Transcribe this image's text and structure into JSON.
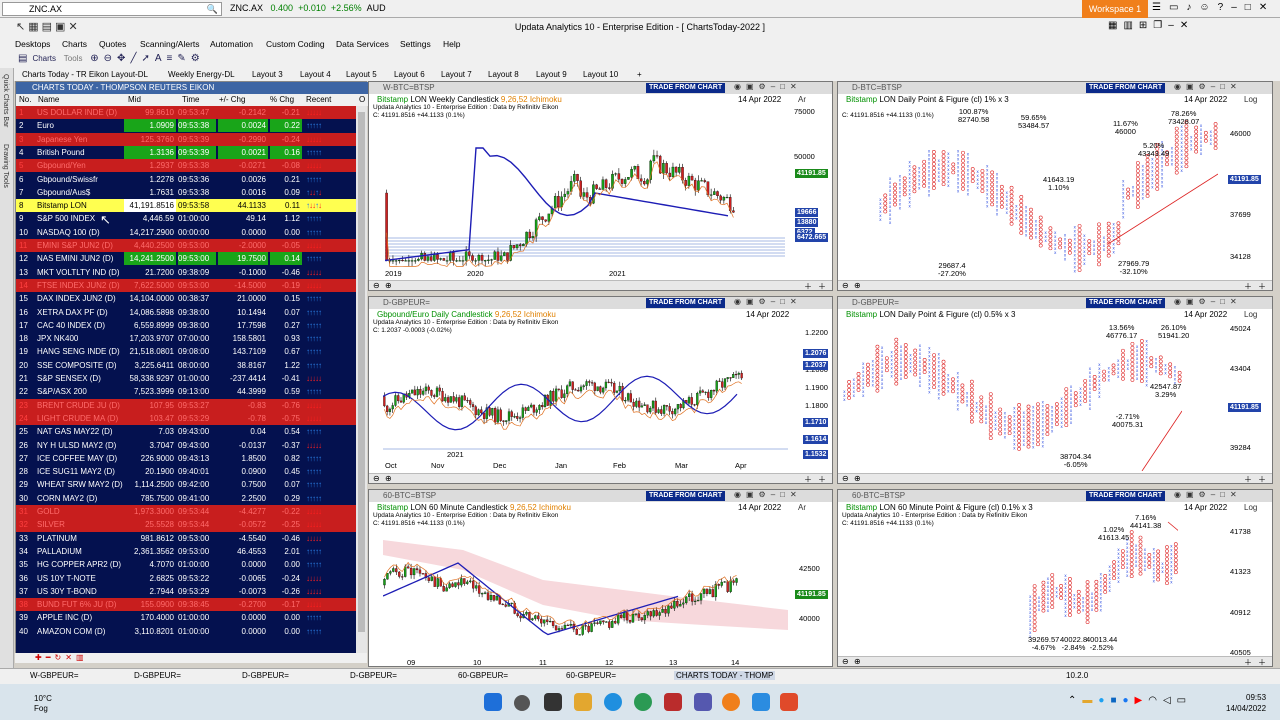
{
  "top": {
    "symbol": "ZNC.AX",
    "quote_symbol": "ZNC.AX",
    "quote_price": "0.400",
    "quote_change": "+0.010",
    "quote_pct": "+2.56%",
    "quote_ccy": "AUD",
    "workspace": "Workspace 1"
  },
  "app_title": "Updata Analytics 10 - Enterprise Edition - [ ChartsToday-2022 ]",
  "menu": [
    "Desktops",
    "Charts",
    "Quotes",
    "Scanning/Alerts",
    "Automation",
    "Custom Coding",
    "Data Services",
    "Settings",
    "Help"
  ],
  "toolbar": {
    "charts_label": "Charts",
    "tools_label": "Tools"
  },
  "layouts": [
    "Charts Today - TR Eikon Layout-DL",
    "Weekly Energy-DL",
    "Layout 3",
    "Layout 4",
    "Layout 5",
    "Layout 6",
    "Layout 7",
    "Layout 8",
    "Layout 9",
    "Layout 10",
    "+"
  ],
  "side_tabs": [
    "Quick Charts Bar",
    "Drawing Tools"
  ],
  "watchlist": {
    "title": "CHARTS TODAY - THOMPSON REUTERS EIKON",
    "columns": [
      "No.",
      "Name",
      "Mid",
      "Time",
      "+/- Chg",
      "% Chg",
      "Recent",
      "O"
    ],
    "rows": [
      {
        "no": "1",
        "name": "US DOLLAR INDE (D)",
        "mid": "99.8610",
        "time": "09:53:47",
        "chg": "-0.2142",
        "pct": "-0.21",
        "style": "red",
        "arrows": "down"
      },
      {
        "no": "2",
        "name": "Euro",
        "mid": "1.0909",
        "time": "09:53:38",
        "chg": "0.0024",
        "pct": "0.22",
        "style": "grn",
        "arrows": "up"
      },
      {
        "no": "3",
        "name": "Japanese Yen",
        "mid": "125.3760",
        "time": "09:53:39",
        "chg": "-0.2990",
        "pct": "-0.24",
        "style": "red",
        "arrows": "down"
      },
      {
        "no": "4",
        "name": "British Pound",
        "mid": "1.3136",
        "time": "09:53:39",
        "chg": "0.0021",
        "pct": "0.16",
        "style": "grn",
        "arrows": "up"
      },
      {
        "no": "5",
        "name": "Gbpound/Yen",
        "mid": "1.2937",
        "time": "09:53:38",
        "chg": "-0.0271",
        "pct": "-0.08",
        "style": "red",
        "arrows": "down"
      },
      {
        "no": "6",
        "name": "Gbpound/Swissfr",
        "mid": "1.2278",
        "time": "09:53:36",
        "chg": "0.0026",
        "pct": "0.21",
        "style": "norm",
        "arrows": "up"
      },
      {
        "no": "7",
        "name": "Gbpound/Aus$",
        "mid": "1.7631",
        "time": "09:53:38",
        "chg": "0.0016",
        "pct": "0.09",
        "style": "norm",
        "arrows": "mix"
      },
      {
        "no": "8",
        "name": "Bitstamp      LON",
        "mid": "41,191.8516",
        "time": "09:53:58",
        "chg": "44.1133",
        "pct": "0.11",
        "style": "sel",
        "arrows": "mix"
      },
      {
        "no": "9",
        "name": "S&P 500 INDEX",
        "mid": "4,446.59",
        "time": "01:00:00",
        "chg": "49.14",
        "pct": "1.12",
        "style": "norm",
        "arrows": "up"
      },
      {
        "no": "10",
        "name": "NASDAQ 100 (D)",
        "mid": "14,217.2900",
        "time": "00:00:00",
        "chg": "0.0000",
        "pct": "0.00",
        "style": "norm",
        "arrows": "up"
      },
      {
        "no": "11",
        "name": "EMINI S&P JUN2 (D)",
        "mid": "4,440.2500",
        "time": "09:53:00",
        "chg": "-2.0000",
        "pct": "-0.05",
        "style": "red",
        "arrows": "down"
      },
      {
        "no": "12",
        "name": "NAS EMINI JUN2 (D)",
        "mid": "14,241.2500",
        "time": "09:53:00",
        "chg": "19.7500",
        "pct": "0.14",
        "style": "grn",
        "arrows": "up"
      },
      {
        "no": "13",
        "name": "MKT VOLTLTY IND (D)",
        "mid": "21.7200",
        "time": "09:38:09",
        "chg": "-0.1000",
        "pct": "-0.46",
        "style": "norm",
        "arrows": "down"
      },
      {
        "no": "14",
        "name": "FTSE INDEX JUN2 (D)",
        "mid": "7,622.5000",
        "time": "09:53:00",
        "chg": "-14.5000",
        "pct": "-0.19",
        "style": "red",
        "arrows": "down"
      },
      {
        "no": "15",
        "name": "DAX INDEX JUN2 (D)",
        "mid": "14,104.0000",
        "time": "00:38:37",
        "chg": "21.0000",
        "pct": "0.15",
        "style": "norm",
        "arrows": "up"
      },
      {
        "no": "16",
        "name": "XETRA DAX PF (D)",
        "mid": "14,086.5898",
        "time": "09:38:00",
        "chg": "10.1494",
        "pct": "0.07",
        "style": "norm",
        "arrows": "up"
      },
      {
        "no": "17",
        "name": "CAC 40 INDEX (D)",
        "mid": "6,559.8999",
        "time": "09:38:00",
        "chg": "17.7598",
        "pct": "0.27",
        "style": "norm",
        "arrows": "up"
      },
      {
        "no": "18",
        "name": "JPX NK400",
        "mid": "17,203.9707",
        "time": "07:00:00",
        "chg": "158.5801",
        "pct": "0.93",
        "style": "norm",
        "arrows": "up"
      },
      {
        "no": "19",
        "name": "HANG SENG INDE (D)",
        "mid": "21,518.0801",
        "time": "09:08:00",
        "chg": "143.7109",
        "pct": "0.67",
        "style": "norm",
        "arrows": "up"
      },
      {
        "no": "20",
        "name": "SSE COMPOSITE (D)",
        "mid": "3,225.6411",
        "time": "08:00:00",
        "chg": "38.8167",
        "pct": "1.22",
        "style": "norm",
        "arrows": "up"
      },
      {
        "no": "21",
        "name": "S&P SENSEX (D)",
        "mid": "58,338.9297",
        "time": "01:00:00",
        "chg": "-237.4414",
        "pct": "-0.41",
        "style": "norm",
        "arrows": "down"
      },
      {
        "no": "22",
        "name": "S&P/ASX 200",
        "mid": "7,523.3999",
        "time": "09:13:00",
        "chg": "44.3999",
        "pct": "0.59",
        "style": "norm",
        "arrows": "up"
      },
      {
        "no": "23",
        "name": "BRENT CRUDE JU (D)",
        "mid": "107.95",
        "time": "09:53:27",
        "chg": "-0.83",
        "pct": "-0.76",
        "style": "red",
        "arrows": "down"
      },
      {
        "no": "24",
        "name": "LIGHT CRUDE MA (D)",
        "mid": "103.47",
        "time": "09:53:29",
        "chg": "-0.78",
        "pct": "-0.75",
        "style": "red",
        "arrows": "down"
      },
      {
        "no": "25",
        "name": "NAT GAS MAY22 (D)",
        "mid": "7.03",
        "time": "09:43:00",
        "chg": "0.04",
        "pct": "0.54",
        "style": "norm",
        "arrows": "up"
      },
      {
        "no": "26",
        "name": "NY H ULSD MAY2 (D)",
        "mid": "3.7047",
        "time": "09:43:00",
        "chg": "-0.0137",
        "pct": "-0.37",
        "style": "norm",
        "arrows": "down"
      },
      {
        "no": "27",
        "name": "ICE COFFEE MAY (D)",
        "mid": "226.9000",
        "time": "09:43:13",
        "chg": "1.8500",
        "pct": "0.82",
        "style": "norm",
        "arrows": "up"
      },
      {
        "no": "28",
        "name": "ICE SUG11 MAY2 (D)",
        "mid": "20.1900",
        "time": "09:40:01",
        "chg": "0.0900",
        "pct": "0.45",
        "style": "norm",
        "arrows": "up"
      },
      {
        "no": "29",
        "name": "WHEAT SRW MAY2 (D)",
        "mid": "1,114.2500",
        "time": "09:42:00",
        "chg": "0.7500",
        "pct": "0.07",
        "style": "norm",
        "arrows": "up"
      },
      {
        "no": "30",
        "name": "CORN MAY2 (D)",
        "mid": "785.7500",
        "time": "09:41:00",
        "chg": "2.2500",
        "pct": "0.29",
        "style": "norm",
        "arrows": "up"
      },
      {
        "no": "31",
        "name": "GOLD",
        "mid": "1,973.3000",
        "time": "09:53:44",
        "chg": "-4.4277",
        "pct": "-0.22",
        "style": "red",
        "arrows": "down"
      },
      {
        "no": "32",
        "name": "SILVER",
        "mid": "25.5528",
        "time": "09:53:44",
        "chg": "-0.0572",
        "pct": "-0.25",
        "style": "red",
        "arrows": "down"
      },
      {
        "no": "33",
        "name": "PLATINUM",
        "mid": "981.8612",
        "time": "09:53:00",
        "chg": "-4.5540",
        "pct": "-0.46",
        "style": "norm",
        "arrows": "down"
      },
      {
        "no": "34",
        "name": "PALLADIUM",
        "mid": "2,361.3562",
        "time": "09:53:00",
        "chg": "46.4553",
        "pct": "2.01",
        "style": "norm",
        "arrows": "up"
      },
      {
        "no": "35",
        "name": "HG COPPER APR2 (D)",
        "mid": "4.7070",
        "time": "01:00:00",
        "chg": "0.0000",
        "pct": "0.00",
        "style": "norm",
        "arrows": "up"
      },
      {
        "no": "36",
        "name": "US 10Y T-NOTE",
        "mid": "2.6825",
        "time": "09:53:22",
        "chg": "-0.0065",
        "pct": "-0.24",
        "style": "norm",
        "arrows": "down"
      },
      {
        "no": "37",
        "name": "US 30Y T-BOND",
        "mid": "2.7944",
        "time": "09:53:29",
        "chg": "-0.0073",
        "pct": "-0.26",
        "style": "norm",
        "arrows": "down"
      },
      {
        "no": "38",
        "name": "BUND FUT 6% JU (D)",
        "mid": "155.0900",
        "time": "09:38:45",
        "chg": "-0.2700",
        "pct": "-0.17",
        "style": "red",
        "arrows": "down"
      },
      {
        "no": "39",
        "name": "APPLE INC (D)",
        "mid": "170.4000",
        "time": "01:00:00",
        "chg": "0.0000",
        "pct": "0.00",
        "style": "norm",
        "arrows": "up"
      },
      {
        "no": "40",
        "name": "AMAZON COM (D)",
        "mid": "3,110.8201",
        "time": "01:00:00",
        "chg": "0.0000",
        "pct": "0.00",
        "style": "norm",
        "arrows": "up"
      }
    ]
  },
  "charts": {
    "tfc": "TRADE FROM CHART",
    "c1": {
      "tab": "W-BTC=BTSP",
      "title_a": "Bitstamp",
      "title_b": "LON Weekly Candlestick",
      "title_c": "9,26,52 Ichimoku",
      "sub": "Updata Analytics 10 - Enterprise Edition : Data by Refinitiv Eikon",
      "close": "C: 41191.8516  +44.1133 (0.1%)",
      "date": "14 Apr 2022",
      "scale": "Ar",
      "yticks": [
        "75000",
        "50000"
      ],
      "tags": [
        "41191.85",
        "19666",
        "13880",
        "6372",
        "6472.665"
      ],
      "xticks": [
        "2019",
        "2020",
        "2021"
      ]
    },
    "c2": {
      "tab": "D-BTC=BTSP",
      "title_a": "Bitstamp",
      "title_b": "LON Daily Point & Figure (cl) 1% x 3",
      "date": "14 Apr 2022",
      "scale": "Log",
      "close": "C: 41191.8516  +44.1133 (0.1%)",
      "yticks": [
        "46000",
        "37699",
        "34128"
      ],
      "tag": "41191.85",
      "labels": [
        "100.87%\n82740.58",
        "59.65%\n53484.57",
        "11.67%\n46000",
        "78.26%\n73428.07",
        "5.20%\n43343.49",
        "41643.19\n1.10%",
        "29687.4\n-27.20%",
        "27969.79\n-32.10%"
      ]
    },
    "c3": {
      "tab": "D-GBPEUR=",
      "title_a": "Gbpound/Euro Daily Candlestick",
      "title_c": "9,26,52 Ichimoku",
      "sub": "Updata Analytics 10 - Enterprise Edition : Data by Refinitiv Eikon",
      "close": "C: 1.2037  -0.0003 (-0.02%)",
      "date": "14 Apr 2022",
      "yticks": [
        "1.2200",
        "1.2000",
        "1.1900",
        "1.1800"
      ],
      "tags": [
        "1.2076",
        "1.2037",
        "1.1710",
        "1.1614",
        "1.1532"
      ],
      "year": "2021",
      "xticks": [
        "Oct",
        "Nov",
        "Dec",
        "Jan",
        "Feb",
        "Mar",
        "Apr"
      ]
    },
    "c4": {
      "tab": "D-GBPEUR=",
      "title_a": "Bitstamp",
      "title_b": "LON Daily Point & Figure (cl) 0.5% x 3",
      "date": "14 Apr 2022",
      "scale": "Log",
      "yticks": [
        "45024",
        "43404",
        "39284"
      ],
      "tag": "41191.85",
      "labels": [
        "13.56%\n46776.17",
        "26.10%\n51941.20",
        "42547.87\n3.29%",
        "-2.71%\n40075.31",
        "38704.34\n-6.05%"
      ]
    },
    "c5": {
      "tab": "60-BTC=BTSP",
      "title_a": "Bitstamp",
      "title_b": "LON 60 Minute Candlestick",
      "title_c": "9,26,52 Ichimoku",
      "sub": "Updata Analytics 10 - Enterprise Edition : Data by Refinitiv Eikon",
      "close": "C: 41191.8516  +44.1133 (0.1%)",
      "date": "14 Apr 2022",
      "scale": "Ar",
      "yticks": [
        "42500",
        "40000"
      ],
      "tag": "41191.85",
      "xticks": [
        "09",
        "10",
        "11",
        "12",
        "13",
        "14"
      ]
    },
    "c6": {
      "tab": "60-BTC=BTSP",
      "title_a": "Bitstamp",
      "title_b": "LON 60 Minute Point & Figure (cl) 0.1% x 3",
      "sub": "Updata Analytics 10 - Enterprise Edition : Data by Refinitiv Eikon",
      "close": "C: 41191.8516  +44.1133 (0.1%)",
      "date": "14 Apr 2022",
      "scale": "Log",
      "yticks": [
        "41738",
        "41323",
        "40912",
        "40505"
      ],
      "labels": [
        "7.16%\n44141.38",
        "1.02%\n41613.45",
        "39269.57\n-4.67%",
        "40022.8\n-2.84%",
        "40013.44\n-2.52%"
      ]
    }
  },
  "tasks": [
    "W-GBPEUR=",
    "D-GBPEUR=",
    "D-GBPEUR=",
    "D-GBPEUR=",
    "60-GBPEUR=",
    "60-GBPEUR=",
    "CHARTS TODAY - THOMP"
  ],
  "tasks_right": "10.2.0",
  "weather": {
    "temp": "10°C",
    "desc": "Fog"
  },
  "clock": {
    "time": "09:53",
    "date": "14/04/2022"
  }
}
